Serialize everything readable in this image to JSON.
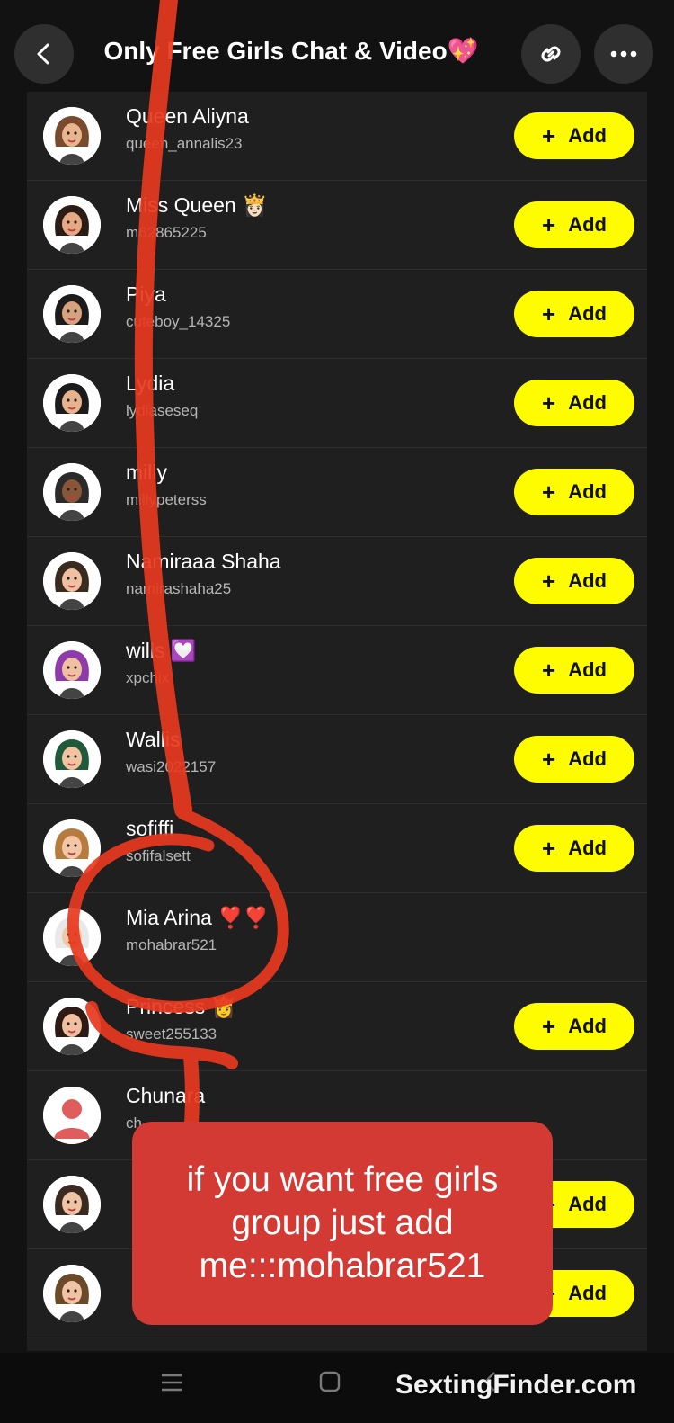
{
  "header": {
    "title": "Only Free Girls Chat & Video💖"
  },
  "add_label": "Add",
  "members": [
    {
      "name": "Queen Aliyna",
      "username": "queen_annalis23",
      "has_add": true,
      "avatar": "avatar-brown-hair-icon"
    },
    {
      "name": "Miss Queen 👸🏻",
      "username": "m62865225",
      "has_add": true,
      "avatar": "avatar-dark-hair-icon"
    },
    {
      "name": "Piya",
      "username": "cuteboy_14325",
      "has_add": true,
      "avatar": "avatar-mask-icon"
    },
    {
      "name": "Lydia",
      "username": "lydiaseseq",
      "has_add": true,
      "avatar": "avatar-bun-icon"
    },
    {
      "name": "milly",
      "username": "millypeterss",
      "has_add": true,
      "avatar": "avatar-cap-icon"
    },
    {
      "name": "Namiraaa Shaha",
      "username": "namirashaha25",
      "has_add": true,
      "avatar": "avatar-flower-crown-icon"
    },
    {
      "name": "wills 💟",
      "username": "xpchix",
      "has_add": true,
      "avatar": "avatar-purple-hair-icon"
    },
    {
      "name": "Wallis",
      "username": "wasi2022157",
      "has_add": true,
      "avatar": "avatar-cowboy-hat-icon"
    },
    {
      "name": "sofiffi",
      "username": "sofifalsett",
      "has_add": true,
      "avatar": "avatar-dog-filter-icon"
    },
    {
      "name": "Mia Arina ❣️❣️",
      "username": "mohabrar521",
      "has_add": false,
      "avatar": "avatar-white-hat-icon"
    },
    {
      "name": "Princess 👸",
      "username": "sweet255133",
      "has_add": true,
      "avatar": "avatar-long-hair-icon"
    },
    {
      "name": "Chunara",
      "username": "ch",
      "has_add": false,
      "avatar": "avatar-placeholder-icon"
    },
    {
      "name": "",
      "username": "",
      "has_add": true,
      "avatar": "avatar-mask-flower-icon"
    },
    {
      "name": "",
      "username": "",
      "has_add": true,
      "avatar": "avatar-blonde-icon"
    }
  ],
  "overlay_text": [
    "if you want free girls",
    "group just add",
    "me:::mohabrar521"
  ],
  "watermark": "SextingFinder.com",
  "colors": {
    "accent": "#fffc00",
    "banner": "#d33a34",
    "scribble": "#e8391f"
  }
}
